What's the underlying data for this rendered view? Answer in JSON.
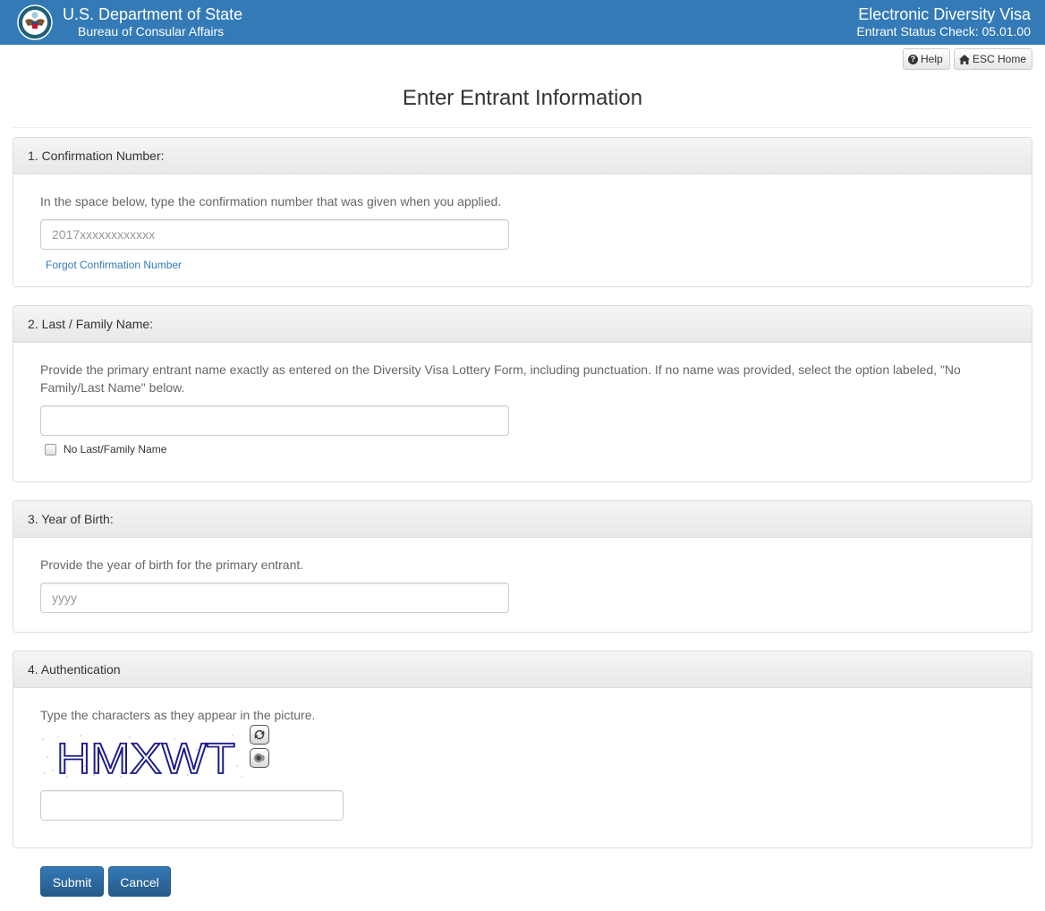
{
  "header": {
    "org_title": "U.S. Department of State",
    "org_subtitle": "Bureau of Consular Affairs",
    "app_title": "Electronic Diversity Visa",
    "app_subtitle": "Entrant Status Check: 05.01.00",
    "brand_color": "#337ab7"
  },
  "toolbar": {
    "help_label": "Help",
    "home_label": "ESC Home"
  },
  "page": {
    "title": "Enter Entrant Information"
  },
  "sections": {
    "confirmation": {
      "heading": "1. Confirmation Number:",
      "instructions": "In the space below, type the confirmation number that was given when you applied.",
      "placeholder": "2017xxxxxxxxxxxx",
      "value": "",
      "forgot_link": "Forgot Confirmation Number"
    },
    "last_name": {
      "heading": "2. Last / Family Name:",
      "instructions": "Provide the primary entrant name exactly as entered on the Diversity Visa Lottery Form, including punctuation. If no name was provided, select the option labeled, \"No Family/Last Name\" below.",
      "value": "",
      "no_name_label": "No Last/Family Name",
      "no_name_checked": false
    },
    "year_of_birth": {
      "heading": "3. Year of Birth:",
      "instructions": "Provide the year of birth for the primary entrant.",
      "placeholder": "yyyy",
      "value": ""
    },
    "authentication": {
      "heading": "4. Authentication",
      "instructions": "Type the characters as they appear in the picture.",
      "captcha_text": "HMXWT",
      "value": ""
    }
  },
  "actions": {
    "submit_label": "Submit",
    "cancel_label": "Cancel"
  }
}
